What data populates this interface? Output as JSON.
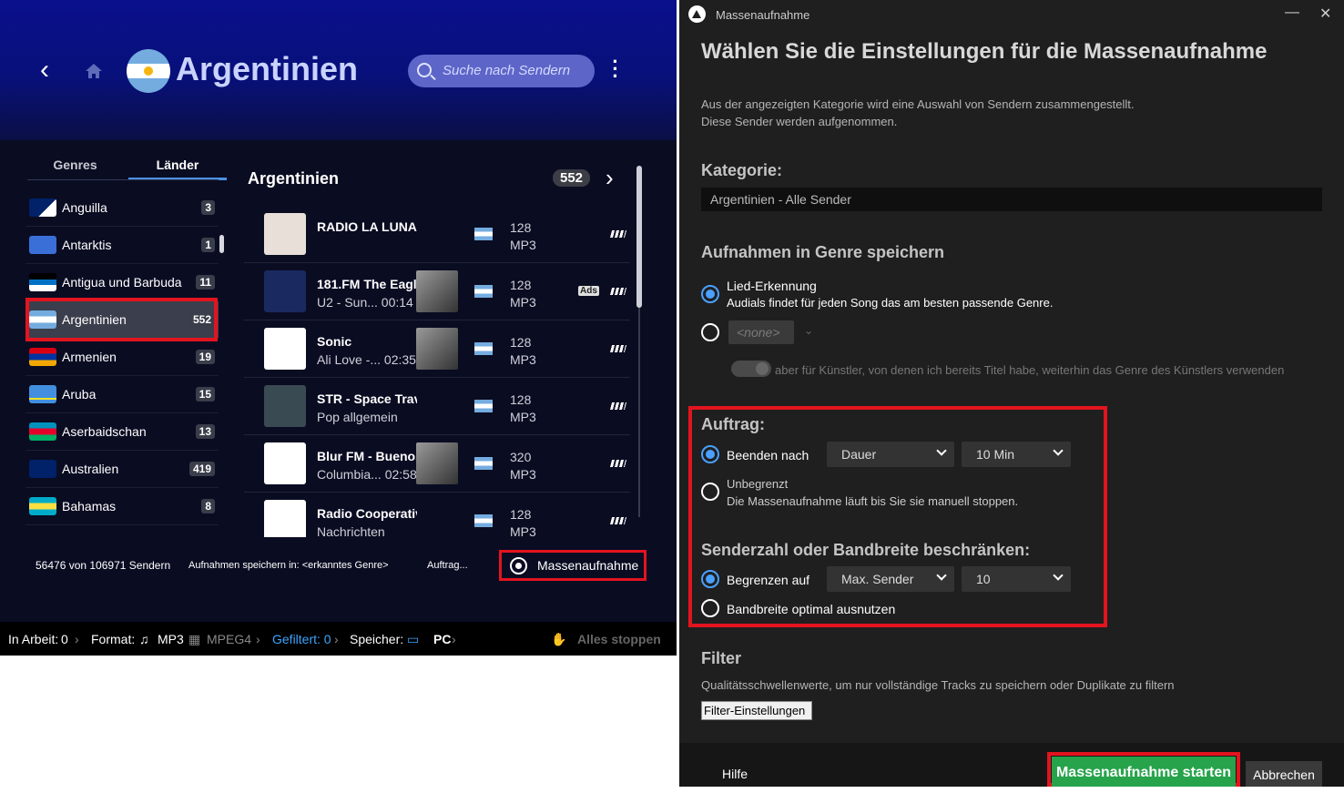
{
  "app": {
    "page_title": "Argentinien",
    "search_placeholder": "Suche nach Sendern",
    "tabs": [
      "Genres",
      "Länder"
    ],
    "countries": [
      {
        "name": "Anguilla",
        "count": "3",
        "flag": "anguilla"
      },
      {
        "name": "Antarktis",
        "count": "1",
        "flag": "antarctica"
      },
      {
        "name": "Antigua und Barbuda",
        "count": "11",
        "flag": "antigua"
      },
      {
        "name": "Argentinien",
        "count": "552",
        "flag": "argentina"
      },
      {
        "name": "Armenien",
        "count": "19",
        "flag": "armenia"
      },
      {
        "name": "Aruba",
        "count": "15",
        "flag": "aruba"
      },
      {
        "name": "Aserbaidschan",
        "count": "13",
        "flag": "azerbaijan"
      },
      {
        "name": "Australien",
        "count": "419",
        "flag": "australia"
      },
      {
        "name": "Bahamas",
        "count": "8",
        "flag": "bahamas"
      }
    ],
    "list_title": "Argentinien",
    "list_count": "552",
    "stations": [
      {
        "name": "RADIO LA LUNA",
        "sub": "",
        "bitrate": "128",
        "format": "MP3",
        "ads": false,
        "logo_color": "#e8e0d8"
      },
      {
        "name": "181.FM The Eagl",
        "sub": "U2 - Sun... 00:14",
        "bitrate": "128",
        "format": "MP3",
        "ads": true,
        "ads_label": "Ads",
        "logo_color": "#1a2a60"
      },
      {
        "name": "Sonic",
        "sub": "Ali Love -... 02:35",
        "bitrate": "128",
        "format": "MP3",
        "ads": false,
        "logo_color": "#ffffff"
      },
      {
        "name": "STR - Space Trav",
        "sub": "Pop allgemein",
        "bitrate": "128",
        "format": "MP3",
        "ads": false,
        "logo_color": "#3a4a52"
      },
      {
        "name": "Blur FM - Buenos",
        "sub": "Columbia... 02:58",
        "bitrate": "320",
        "format": "MP3",
        "ads": false,
        "logo_color": "#ffffff"
      },
      {
        "name": "Radio Cooperativ",
        "sub": "Nachrichten",
        "bitrate": "128",
        "format": "MP3",
        "ads": false,
        "logo_color": "#ffffff"
      }
    ],
    "footer": {
      "count_text": "56476 von 106971 Sendern",
      "save_text": "Aufnahmen speichern in: <erkanntes Genre>",
      "job_text": "Auftrag...",
      "mass_label": "Massenaufnahme"
    },
    "status": {
      "in_work": "In Arbeit:",
      "in_work_val": "0",
      "format_label": "Format:",
      "mp3": "MP3",
      "mpeg4": "MPEG4",
      "filtered": "Gefiltert: 0",
      "storage_label": "Speicher:",
      "pc": "PC",
      "stop_all": "Alles stoppen"
    }
  },
  "dialog": {
    "window_title": "Massenaufnahme",
    "heading": "Wählen Sie die Einstellungen für die Massenaufnahme",
    "intro_line1": "Aus der angezeigten Kategorie wird eine Auswahl von Sendern zusammengestellt.",
    "intro_line2": "Diese Sender werden aufgenommen.",
    "category_label": "Kategorie:",
    "category_value": "Argentinien - Alle Sender",
    "genre_section": "Aufnahmen in Genre speichern",
    "song_detect_label": "Lied-Erkennung",
    "song_detect_sub": "Audials findet für jeden Song das am besten passende Genre.",
    "none_option": "<none>",
    "artist_toggle_label": "aber für Künstler, von denen ich bereits Titel habe, weiterhin das Genre des Künstlers verwenden",
    "job_section": "Auftrag:",
    "end_after_label": "Beenden nach",
    "end_after_type": "Dauer",
    "end_after_value": "10 Min",
    "unlimited_label": "Unbegrenzt",
    "unlimited_sub": "Die Massenaufnahme läuft bis Sie sie manuell stoppen.",
    "limit_section": "Senderzahl oder Bandbreite beschränken:",
    "limit_to_label": "Begrenzen auf",
    "limit_type": "Max. Sender",
    "limit_value": "10",
    "bandwidth_label": "Bandbreite optimal ausnutzen",
    "filter_section": "Filter",
    "filter_desc": "Qualitätsschwellenwerte, um nur vollständige Tracks zu speichern oder Duplikate zu filtern",
    "filter_button": "Filter-Einstellungen",
    "help": "Hilfe",
    "start_button": "Massenaufnahme starten",
    "cancel_button": "Abbrechen"
  }
}
